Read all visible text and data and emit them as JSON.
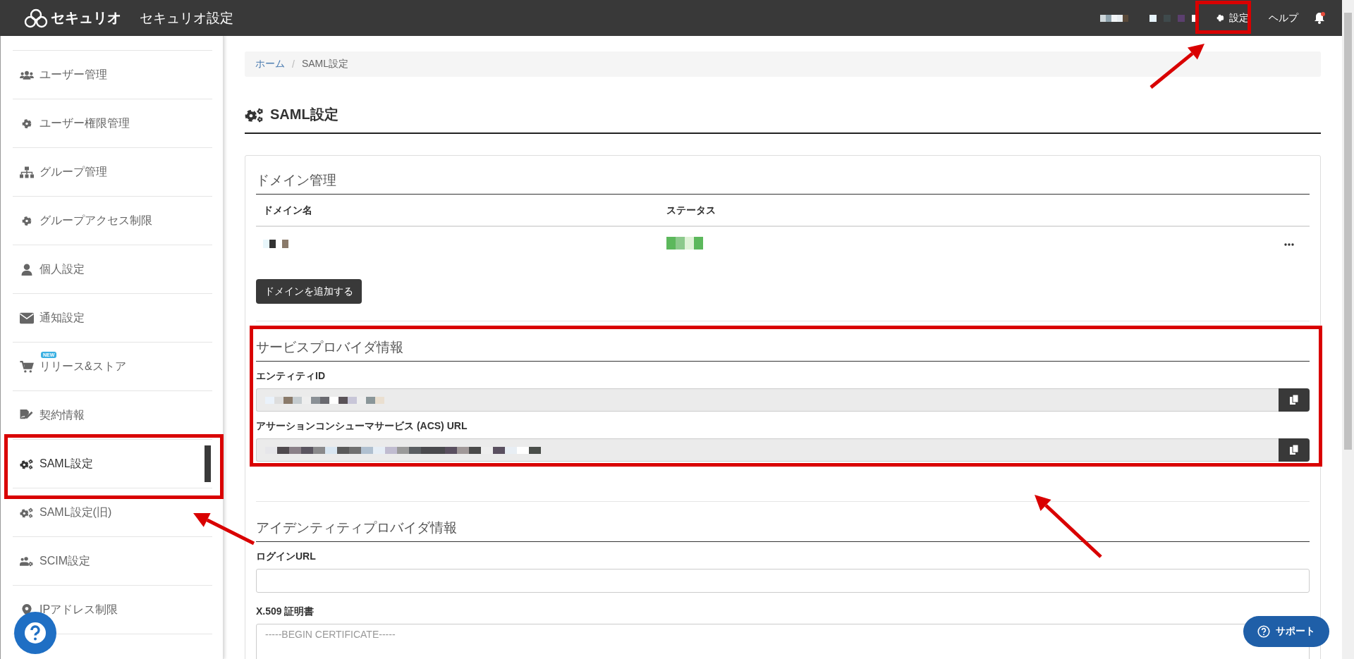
{
  "header": {
    "logo": "セキュリオ",
    "title": "セキュリオ設定",
    "links": [
      {
        "label": "設定"
      },
      {
        "label": "ヘルプ"
      }
    ],
    "notification_dot": true
  },
  "sidebar": {
    "items": [
      {
        "label": "ユーザー管理",
        "selected": false
      },
      {
        "label": "ユーザー権限管理",
        "selected": false
      },
      {
        "label": "グループ管理",
        "selected": false
      },
      {
        "label": "グループアクセス制限",
        "selected": false
      },
      {
        "label": "個人設定",
        "selected": false
      },
      {
        "label": "通知設定",
        "selected": false
      },
      {
        "label": "リリース&ストア",
        "selected": false,
        "badge": "NEW"
      },
      {
        "label": "契約情報",
        "selected": false
      },
      {
        "label": "SAML設定",
        "selected": true
      },
      {
        "label": "SAML設定(旧)",
        "selected": false
      },
      {
        "label": "SCIM設定",
        "selected": false
      },
      {
        "label": "IPアドレス制限",
        "selected": false
      }
    ]
  },
  "breadcrumb": [
    {
      "label": "ホーム"
    },
    {
      "label": "SAML設定"
    }
  ],
  "breadcrumb_separator": "/",
  "page_title": "SAML設定",
  "domain_section": {
    "title": "ドメイン管理",
    "columns": [
      "ドメイン名",
      "ステータス"
    ],
    "add_button": "ドメインを追加する"
  },
  "sp_section": {
    "title": "サービスプロバイダ情報",
    "fields": [
      {
        "label": "エンティティID"
      },
      {
        "label": "アサーションコンシューマサービス (ACS) URL"
      }
    ]
  },
  "idp_section": {
    "title": "アイデンティティプロバイダ情報",
    "login_url": {
      "label": "ログインURL"
    },
    "certificate": {
      "label": "X.509 証明書",
      "placeholder": "-----BEGIN CERTIFICATE-----"
    }
  },
  "support_button": "サポート"
}
